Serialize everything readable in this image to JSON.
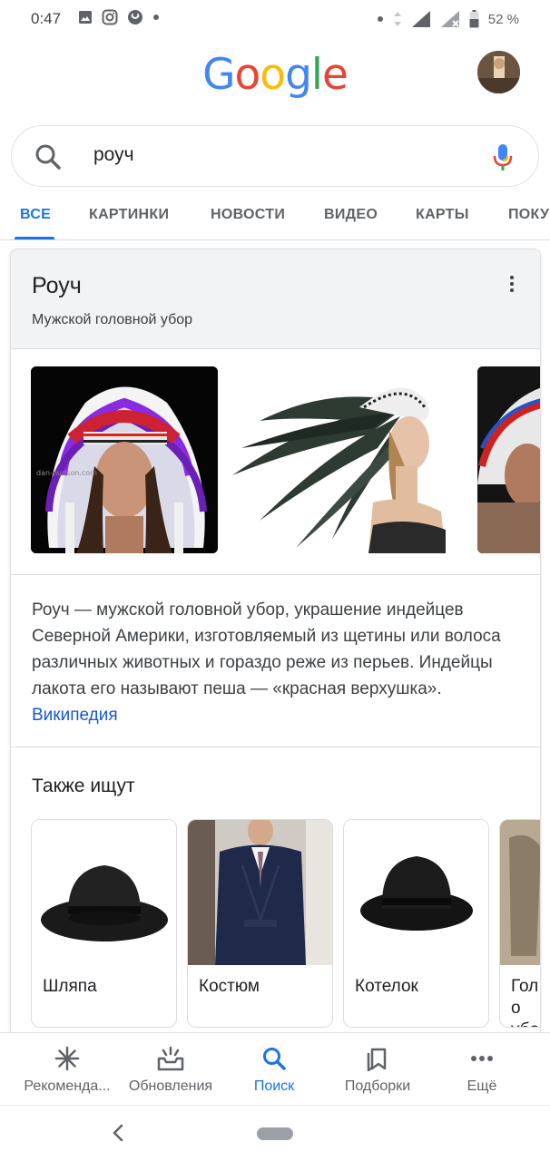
{
  "status_bar": {
    "time": "0:47",
    "battery": "52 %"
  },
  "header": {
    "logo": [
      "G",
      "o",
      "o",
      "g",
      "l",
      "e"
    ],
    "logo_colors": [
      "#4285F4",
      "#EA4335",
      "#FBBC05",
      "#4285F4",
      "#34A853",
      "#EA4335"
    ]
  },
  "search": {
    "query": "роуч"
  },
  "tabs": [
    {
      "label": "ВСЕ"
    },
    {
      "label": "КАРТИНКИ"
    },
    {
      "label": "НОВОСТИ"
    },
    {
      "label": "ВИДЕО"
    },
    {
      "label": "КАРТЫ"
    },
    {
      "label": "ПОКУ"
    }
  ],
  "knowledge_panel": {
    "title": "Роуч",
    "subtitle": "Мужской головной убор",
    "description": "Роуч — мужской головной убор, украшение индейцев Северной Америки, изготовляемый из щетины или волоса различных животных и гораздо реже из перьев. Индейцы лакота его называют пеша — «красная верхушка».",
    "source_link": "Википедия",
    "watermark": "dan-hudson.com"
  },
  "also_searched": {
    "title": "Также ищут",
    "items": [
      {
        "label": "Шляпа"
      },
      {
        "label": "Костюм"
      },
      {
        "label": "Котелок"
      },
      {
        "label": "Голо убор"
      }
    ]
  },
  "bottom_nav": [
    {
      "label": "Рекоменда...",
      "icon": "asterisk-icon"
    },
    {
      "label": "Обновления",
      "icon": "updates-icon"
    },
    {
      "label": "Поиск",
      "icon": "search-icon"
    },
    {
      "label": "Подборки",
      "icon": "collections-icon"
    },
    {
      "label": "Ещё",
      "icon": "more-horiz-icon"
    }
  ],
  "colors": {
    "accent": "#1a73e8",
    "link": "#1558d6",
    "text": "#202124",
    "muted": "#5f6368"
  }
}
